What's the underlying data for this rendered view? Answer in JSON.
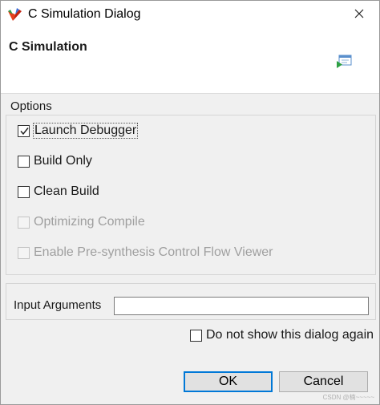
{
  "window": {
    "title": "C Simulation Dialog",
    "app_icon": "vitis-hls-icon",
    "close_icon": "close-icon"
  },
  "header": {
    "title": "C Simulation",
    "icon": "csim-run-icon"
  },
  "options": {
    "group_label": "Options",
    "items": [
      {
        "label": "Launch Debugger",
        "checked": true,
        "enabled": true
      },
      {
        "label": "Build Only",
        "checked": false,
        "enabled": true
      },
      {
        "label": "Clean Build",
        "checked": false,
        "enabled": true
      },
      {
        "label": "Optimizing Compile",
        "checked": false,
        "enabled": false
      },
      {
        "label": "Enable Pre-synthesis Control Flow Viewer",
        "checked": false,
        "enabled": false
      }
    ]
  },
  "arguments": {
    "label": "Input Arguments",
    "value": ""
  },
  "dont_show": {
    "label": "Do not show this dialog again",
    "checked": false
  },
  "buttons": {
    "ok": "OK",
    "cancel": "Cancel"
  },
  "watermark": "CSDN @楠~~~~~"
}
